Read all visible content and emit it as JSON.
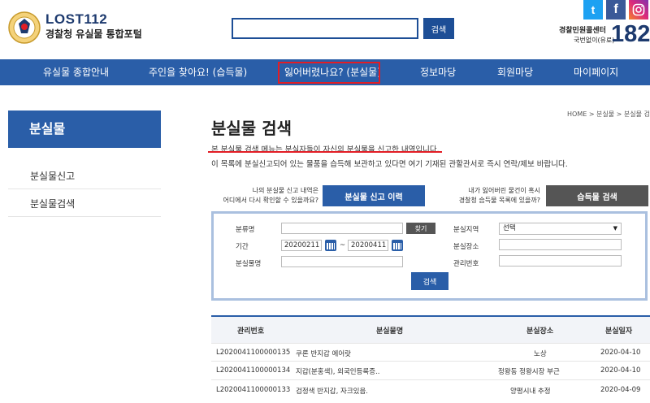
{
  "header": {
    "logo_title": "LOST112",
    "logo_subtitle": "경찰청 유실물 통합포털",
    "search_placeholder": "",
    "search_button": "검색",
    "social": {
      "twitter": "t",
      "facebook": "f"
    },
    "call_center_label": "경찰민원콜센터",
    "call_free_label": "국번없이(유료)",
    "call_number": "182",
    "colors": {
      "brand": "#1d3a6e",
      "nav": "#2a5ea8",
      "highlight": "#e21d25"
    }
  },
  "nav": {
    "items": [
      "유실물 종합안내",
      "주인을 찾아요! (습득물)",
      "잃어버렸나요? (분실물)",
      "정보마당",
      "회원마당",
      "마이페이지"
    ]
  },
  "sidebar": {
    "title": "분실물",
    "items": [
      "분실물신고",
      "분실물검색"
    ]
  },
  "main": {
    "breadcrumb": "HOME > 분실물 > 분실물 검색",
    "title": "분실물 검색",
    "desc1": "본 분실물 검색 메뉴는 분실자들이 자신의 분실물을 신고한 내역입니다.",
    "desc2": "이 목록에 분실신고되어 있는 물품을 습득해 보관하고 있다면 여기 기재된 관할관서로 즉시 연락/제보 바랍니다.",
    "ask_left_1": "나의 분실물 신고 내역은",
    "ask_left_2": "어디에서 다시 확인할 수 있을까요?",
    "btn_history": "분실물 신고 이력",
    "ask_right_1": "내가 잃어버린 물건이 혹시",
    "ask_right_2": "경찰청 습득물 목록에 있을까?",
    "btn_found": "습득물 검색"
  },
  "form": {
    "label_category": "분류명",
    "find_button": "찾기",
    "label_period": "기간",
    "date_from": "20200211",
    "date_sep": "~",
    "date_to": "20200411",
    "label_item_name": "분실물명",
    "label_region": "분실지역",
    "region_selected": "선택",
    "label_place": "분실장소",
    "label_manage_no": "관리번호",
    "search_button": "검색"
  },
  "table": {
    "headers": [
      "관리번호",
      "분실물명",
      "분실장소",
      "분실일자"
    ],
    "rows": [
      [
        "L2020041100000135",
        "쿠론 반지갑 에어랏",
        "노상",
        "2020-04-10"
      ],
      [
        "L2020041100000134",
        "지갑(분홍색), 외국인등록증..",
        "정왕동 정왕시장 부근",
        "2020-04-10"
      ],
      [
        "L2020041100000133",
        "검정색 반지갑, 자크있음.",
        "양평시내 추정",
        "2020-04-09"
      ]
    ]
  }
}
